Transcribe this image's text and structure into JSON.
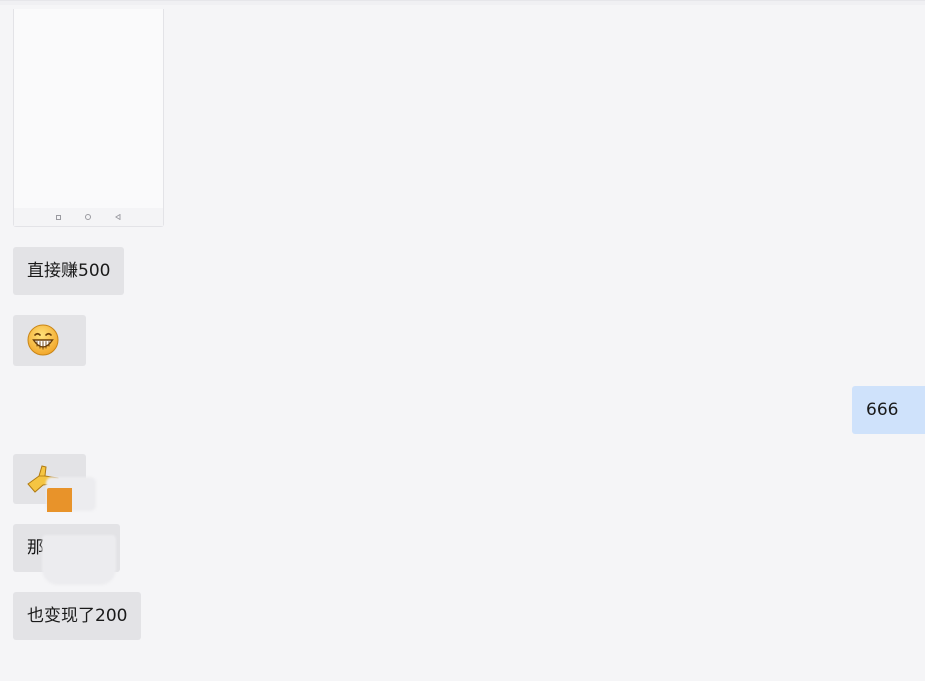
{
  "messages": [
    {
      "kind": "image",
      "direction": "incoming",
      "content": "phone-screenshot"
    },
    {
      "kind": "text",
      "direction": "incoming",
      "text": "直接赚500"
    },
    {
      "kind": "emoji",
      "direction": "incoming",
      "icon": "grinning-face-icon"
    },
    {
      "kind": "text",
      "direction": "outgoing",
      "text": "666"
    },
    {
      "kind": "emoji",
      "direction": "incoming",
      "icon": "pointing-hand-icon"
    },
    {
      "kind": "text",
      "direction": "incoming",
      "text": "那"
    },
    {
      "kind": "text",
      "direction": "incoming",
      "text": "也变现了200"
    }
  ],
  "colors": {
    "background": "#f5f5f7",
    "incoming_bubble": "#e3e3e6",
    "outgoing_bubble": "#cfe2fb"
  }
}
